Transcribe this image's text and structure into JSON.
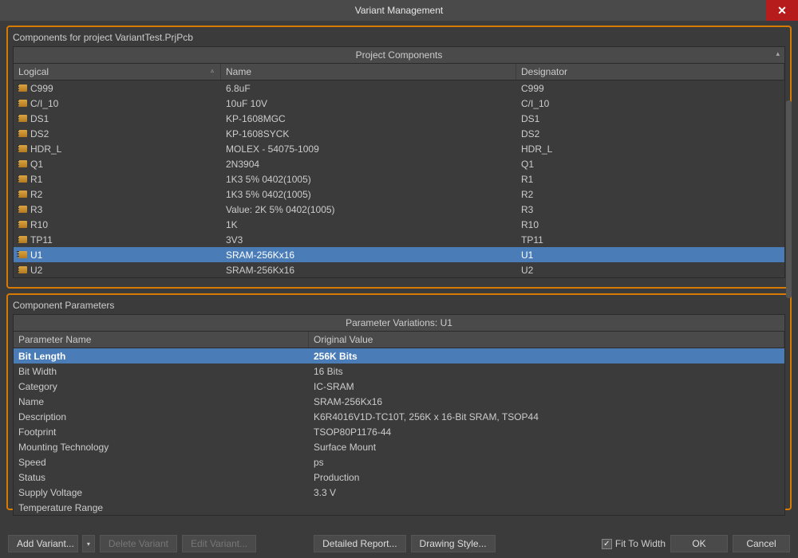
{
  "title": "Variant Management",
  "upper": {
    "section_label": "Components for project VariantTest.PrjPcb",
    "banner": "Project Components",
    "columns": {
      "logical": "Logical",
      "name": "Name",
      "designator": "Designator"
    },
    "rows": [
      {
        "logical": "C999",
        "name": "6.8uF",
        "designator": "C999"
      },
      {
        "logical": "C/I_10",
        "name": "10uF 10V",
        "designator": "C/I_10"
      },
      {
        "logical": "DS1",
        "name": "KP-1608MGC",
        "designator": "DS1"
      },
      {
        "logical": "DS2",
        "name": "KP-1608SYCK",
        "designator": "DS2"
      },
      {
        "logical": "HDR_L",
        "name": "MOLEX - 54075-1009",
        "designator": "HDR_L"
      },
      {
        "logical": "Q1",
        "name": "2N3904",
        "designator": "Q1"
      },
      {
        "logical": "R1",
        "name": "1K3 5% 0402(1005)",
        "designator": "R1"
      },
      {
        "logical": "R2",
        "name": "1K3 5% 0402(1005)",
        "designator": "R2"
      },
      {
        "logical": "R3",
        "name": "Value: 2K 5% 0402(1005)",
        "designator": "R3"
      },
      {
        "logical": "R10",
        "name": "1K",
        "designator": "R10"
      },
      {
        "logical": "TP11",
        "name": "3V3",
        "designator": "TP11"
      },
      {
        "logical": "U1",
        "name": "SRAM-256Kx16",
        "designator": "U1",
        "selected": true
      },
      {
        "logical": "U2",
        "name": "SRAM-256Kx16",
        "designator": "U2"
      }
    ]
  },
  "lower": {
    "section_label": "Component Parameters",
    "banner": "Parameter Variations: U1",
    "columns": {
      "pname": "Parameter Name",
      "pval": "Original Value"
    },
    "rows": [
      {
        "pname": "Bit Length",
        "pval": "256K Bits",
        "selected": true
      },
      {
        "pname": "Bit Width",
        "pval": "16 Bits"
      },
      {
        "pname": "Category",
        "pval": "IC-SRAM"
      },
      {
        "pname": "Name",
        "pval": "SRAM-256Kx16"
      },
      {
        "pname": "Description",
        "pval": "K6R4016V1D-TC10T, 256K x 16-Bit SRAM, TSOP44"
      },
      {
        "pname": "Footprint",
        "pval": "TSOP80P1176-44"
      },
      {
        "pname": "Mounting Technology",
        "pval": "Surface Mount"
      },
      {
        "pname": "Speed",
        "pval": "ps"
      },
      {
        "pname": "Status",
        "pval": "Production"
      },
      {
        "pname": "Supply Voltage",
        "pval": "3.3 V"
      },
      {
        "pname": "Temperature Range",
        "pval": "<empty>"
      }
    ]
  },
  "buttons": {
    "add_variant": "Add Variant...",
    "delete_variant": "Delete Variant",
    "edit_variant": "Edit Variant...",
    "detailed_report": "Detailed Report...",
    "drawing_style": "Drawing Style...",
    "fit_to_width": "Fit To Width",
    "ok": "OK",
    "cancel": "Cancel"
  }
}
